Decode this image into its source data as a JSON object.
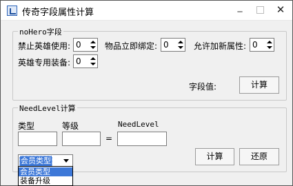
{
  "window": {
    "title": "传奇字段属性计算",
    "minimize": "_",
    "close": "✕"
  },
  "hero_group": {
    "legend": "noHero字段",
    "fields": [
      {
        "label": "禁止英雄使用:",
        "value": "0"
      },
      {
        "label": "物品立即绑定:",
        "value": "0"
      },
      {
        "label": "允许加新属性:",
        "value": "0"
      },
      {
        "label": "英雄专用装备:",
        "value": "0"
      }
    ],
    "result_label": "字段值:",
    "calc_button": "计算"
  },
  "needlevel_group": {
    "legend": "NeedLevel计算",
    "type_label": "类型",
    "level_label": "等级",
    "needlevel_label": "NeedLevel",
    "equals": "=",
    "type_value": "",
    "level_value": "",
    "needlevel_value": "",
    "combo_selected": "会员类型",
    "combo_options": [
      "会员类型",
      "装备升级"
    ],
    "calc_button": "计算",
    "reset_button": "还原"
  },
  "icons": {
    "app": "app-icon",
    "minimize": "minimize-icon",
    "maximize": "maximize-icon",
    "close": "close-icon"
  }
}
